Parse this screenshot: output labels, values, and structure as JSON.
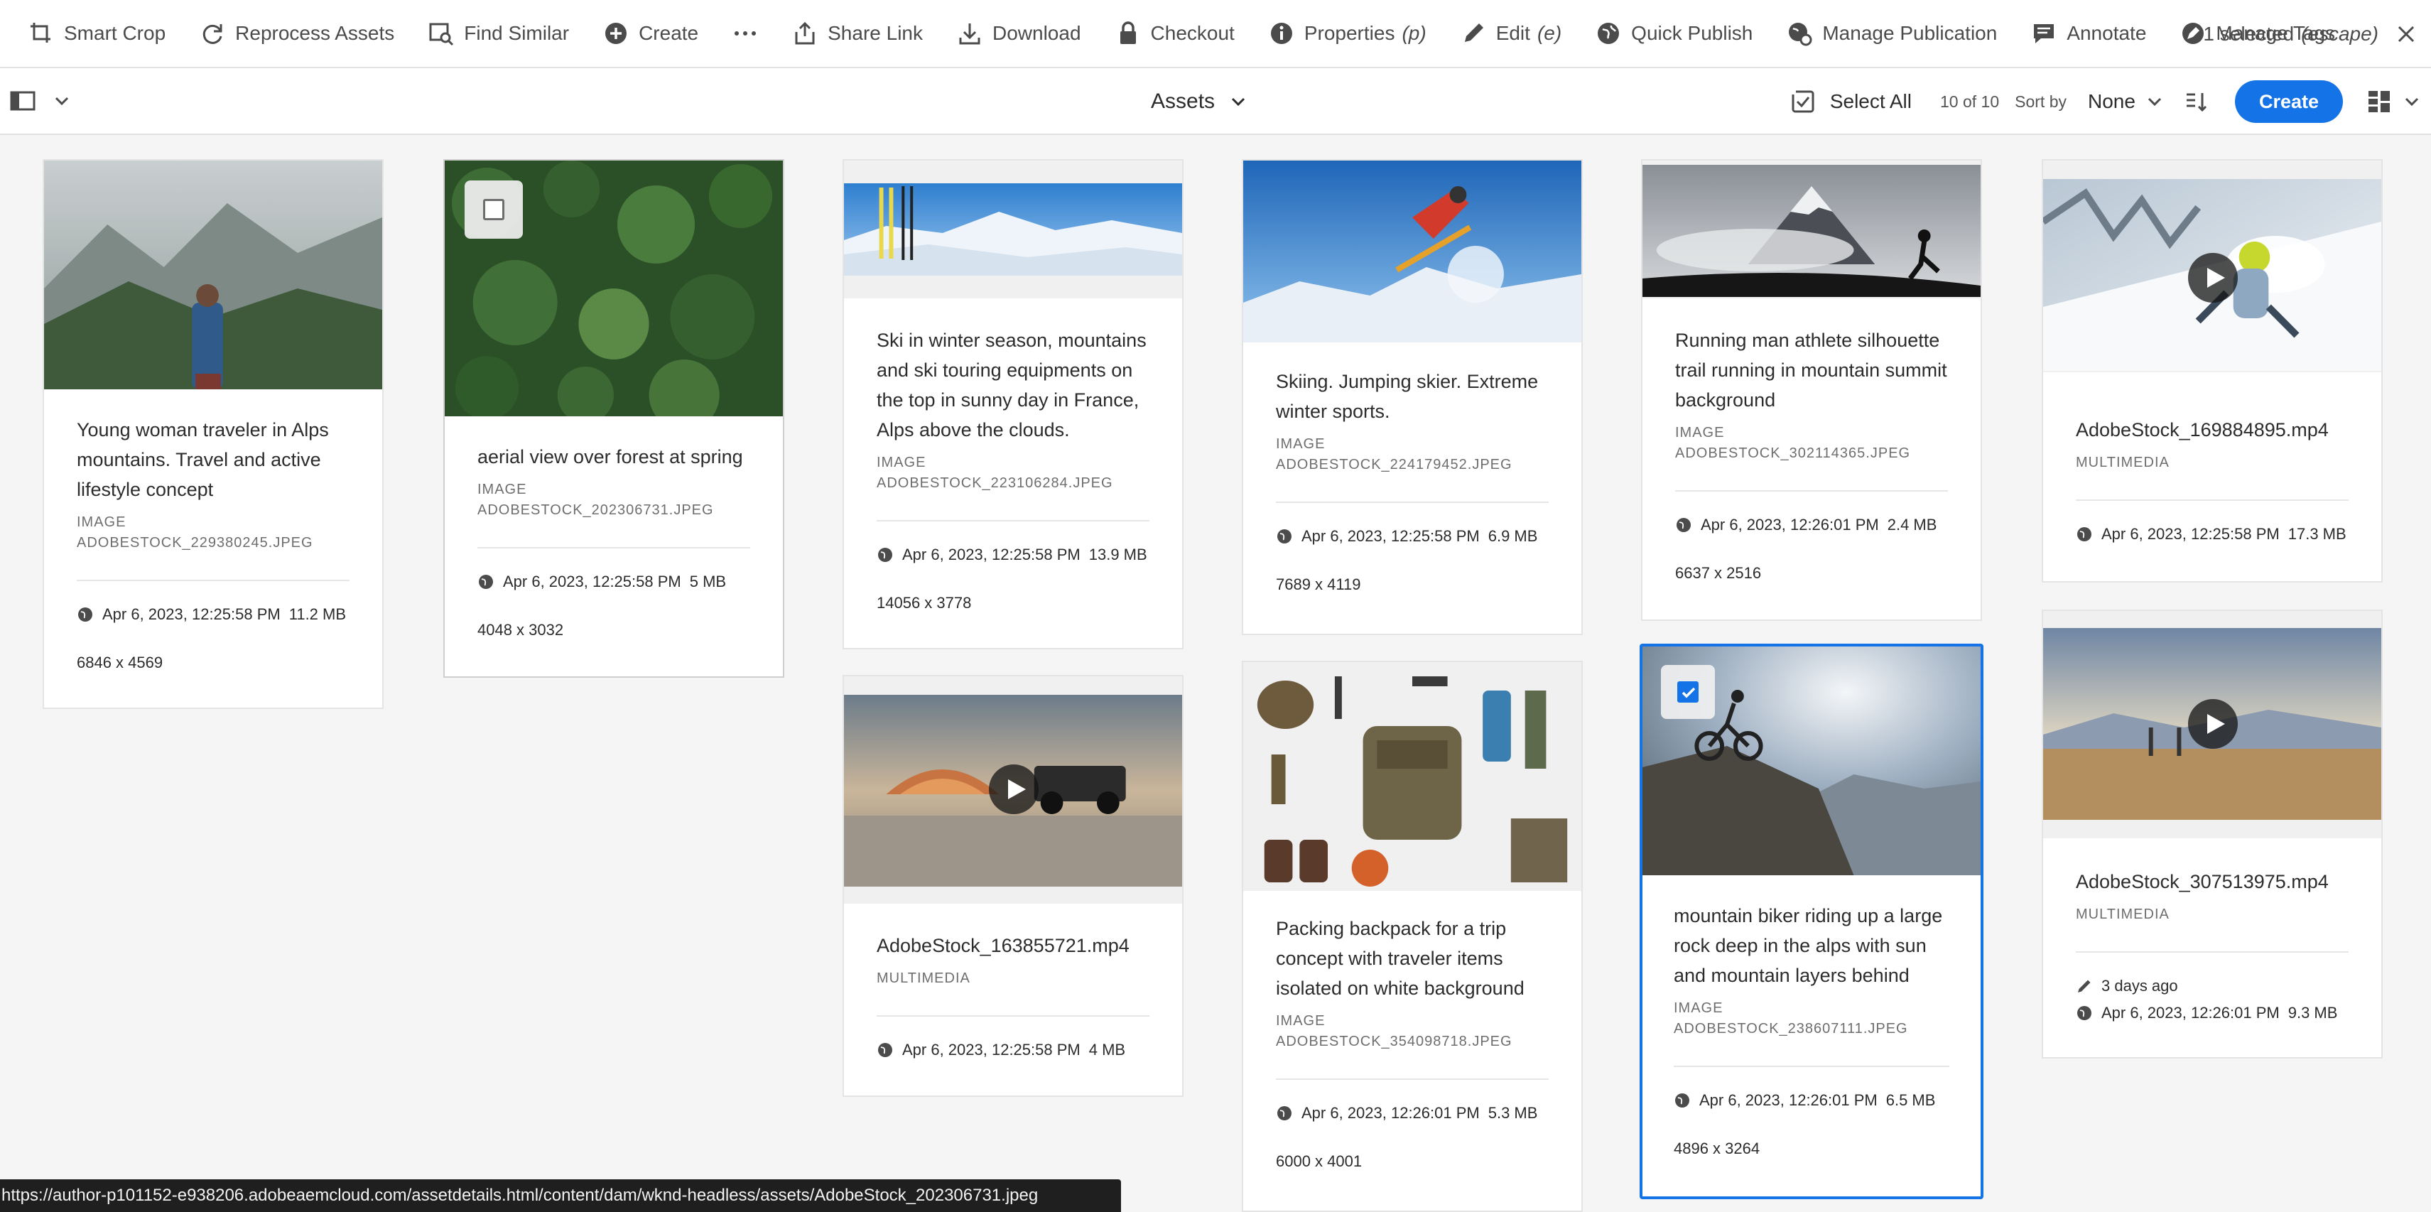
{
  "actionbar": {
    "items": [
      {
        "label": "Smart Crop",
        "shortcut": "",
        "icon": "smart-crop-icon"
      },
      {
        "label": "Reprocess Assets",
        "shortcut": "",
        "icon": "refresh-icon"
      },
      {
        "label": "Find Similar",
        "shortcut": "",
        "icon": "image-search-icon"
      },
      {
        "label": "Create",
        "shortcut": "",
        "icon": "add-circle-icon"
      },
      {
        "label": "Share Link",
        "shortcut": "",
        "icon": "share-icon"
      },
      {
        "label": "Download",
        "shortcut": "",
        "icon": "download-icon"
      },
      {
        "label": "Checkout",
        "shortcut": "",
        "icon": "lock-icon"
      },
      {
        "label": "Properties",
        "shortcut": "(p)",
        "icon": "info-icon"
      },
      {
        "label": "Edit",
        "shortcut": "(e)",
        "icon": "edit-icon"
      },
      {
        "label": "Quick Publish",
        "shortcut": "",
        "icon": "globe-icon"
      },
      {
        "label": "Manage Publication",
        "shortcut": "",
        "icon": "globe-gear-icon"
      },
      {
        "label": "Annotate",
        "shortcut": "",
        "icon": "comment-icon"
      },
      {
        "label": "Manage Tags",
        "shortcut": "",
        "icon": "tag-icon"
      }
    ],
    "more_icon": "more-horizontal-icon",
    "selection_text": "1 selected",
    "selection_shortcut": "(escape)"
  },
  "toolbar": {
    "title": "Assets",
    "select_all": "Select All",
    "count": "10 of 10",
    "sort_by_label": "Sort by",
    "sort_value": "None",
    "create_label": "Create"
  },
  "accent_color": "#1473e6",
  "cards": [
    {
      "title": "Young woman traveler in Alps mountains. Travel and active lifestyle concept",
      "type": "IMAGE",
      "file": "ADOBESTOCK_229380245.JPEG",
      "date": "Apr 6, 2023, 12:25:58 PM",
      "size": "11.2 MB",
      "dims": "6846 x 4569",
      "modified": ""
    },
    {
      "title": "aerial view over forest at spring",
      "type": "IMAGE",
      "file": "ADOBESTOCK_202306731.JPEG",
      "date": "Apr 6, 2023, 12:25:58 PM",
      "size": "5 MB",
      "dims": "4048 x 3032",
      "modified": ""
    },
    {
      "title": "Ski in winter season, mountains and ski touring equipments on the top in sunny day in France, Alps above the clouds.",
      "type": "IMAGE",
      "file": "ADOBESTOCK_223106284.JPEG",
      "date": "Apr 6, 2023, 12:25:58 PM",
      "size": "13.9 MB",
      "dims": "14056 x 3778",
      "modified": ""
    },
    {
      "title": "Skiing. Jumping skier. Extreme winter sports.",
      "type": "IMAGE",
      "file": "ADOBESTOCK_224179452.JPEG",
      "date": "Apr 6, 2023, 12:25:58 PM",
      "size": "6.9 MB",
      "dims": "7689 x 4119",
      "modified": ""
    },
    {
      "title": "Running man athlete silhouette trail running in mountain summit background",
      "type": "IMAGE",
      "file": "ADOBESTOCK_302114365.JPEG",
      "date": "Apr 6, 2023, 12:26:01 PM",
      "size": "2.4 MB",
      "dims": "6637 x 2516",
      "modified": ""
    },
    {
      "title": "AdobeStock_169884895.mp4",
      "type": "MULTIMEDIA",
      "file": "",
      "date": "Apr 6, 2023, 12:25:58 PM",
      "size": "17.3 MB",
      "dims": "",
      "modified": ""
    },
    {
      "title": "AdobeStock_163855721.mp4",
      "type": "MULTIMEDIA",
      "file": "",
      "date": "Apr 6, 2023, 12:25:58 PM",
      "size": "4 MB",
      "dims": "",
      "modified": ""
    },
    {
      "title": "Packing backpack for a trip concept with traveler items isolated on white background",
      "type": "IMAGE",
      "file": "ADOBESTOCK_354098718.JPEG",
      "date": "Apr 6, 2023, 12:26:01 PM",
      "size": "5.3 MB",
      "dims": "6000 x 4001",
      "modified": ""
    },
    {
      "title": "mountain biker riding up a large rock deep in the alps with sun and mountain layers behind",
      "type": "IMAGE",
      "file": "ADOBESTOCK_238607111.JPEG",
      "date": "Apr 6, 2023, 12:26:01 PM",
      "size": "6.5 MB",
      "dims": "4896 x 3264",
      "modified": ""
    },
    {
      "title": "AdobeStock_307513975.mp4",
      "type": "MULTIMEDIA",
      "file": "",
      "date": "Apr 6, 2023, 12:26:01 PM",
      "size": "9.3 MB",
      "dims": "",
      "modified": "3 days ago"
    }
  ],
  "statusbar_url": "https://author-p101152-e938206.adobeaemcloud.com/assetdetails.html/content/dam/wknd-headless/assets/AdobeStock_202306731.jpeg"
}
